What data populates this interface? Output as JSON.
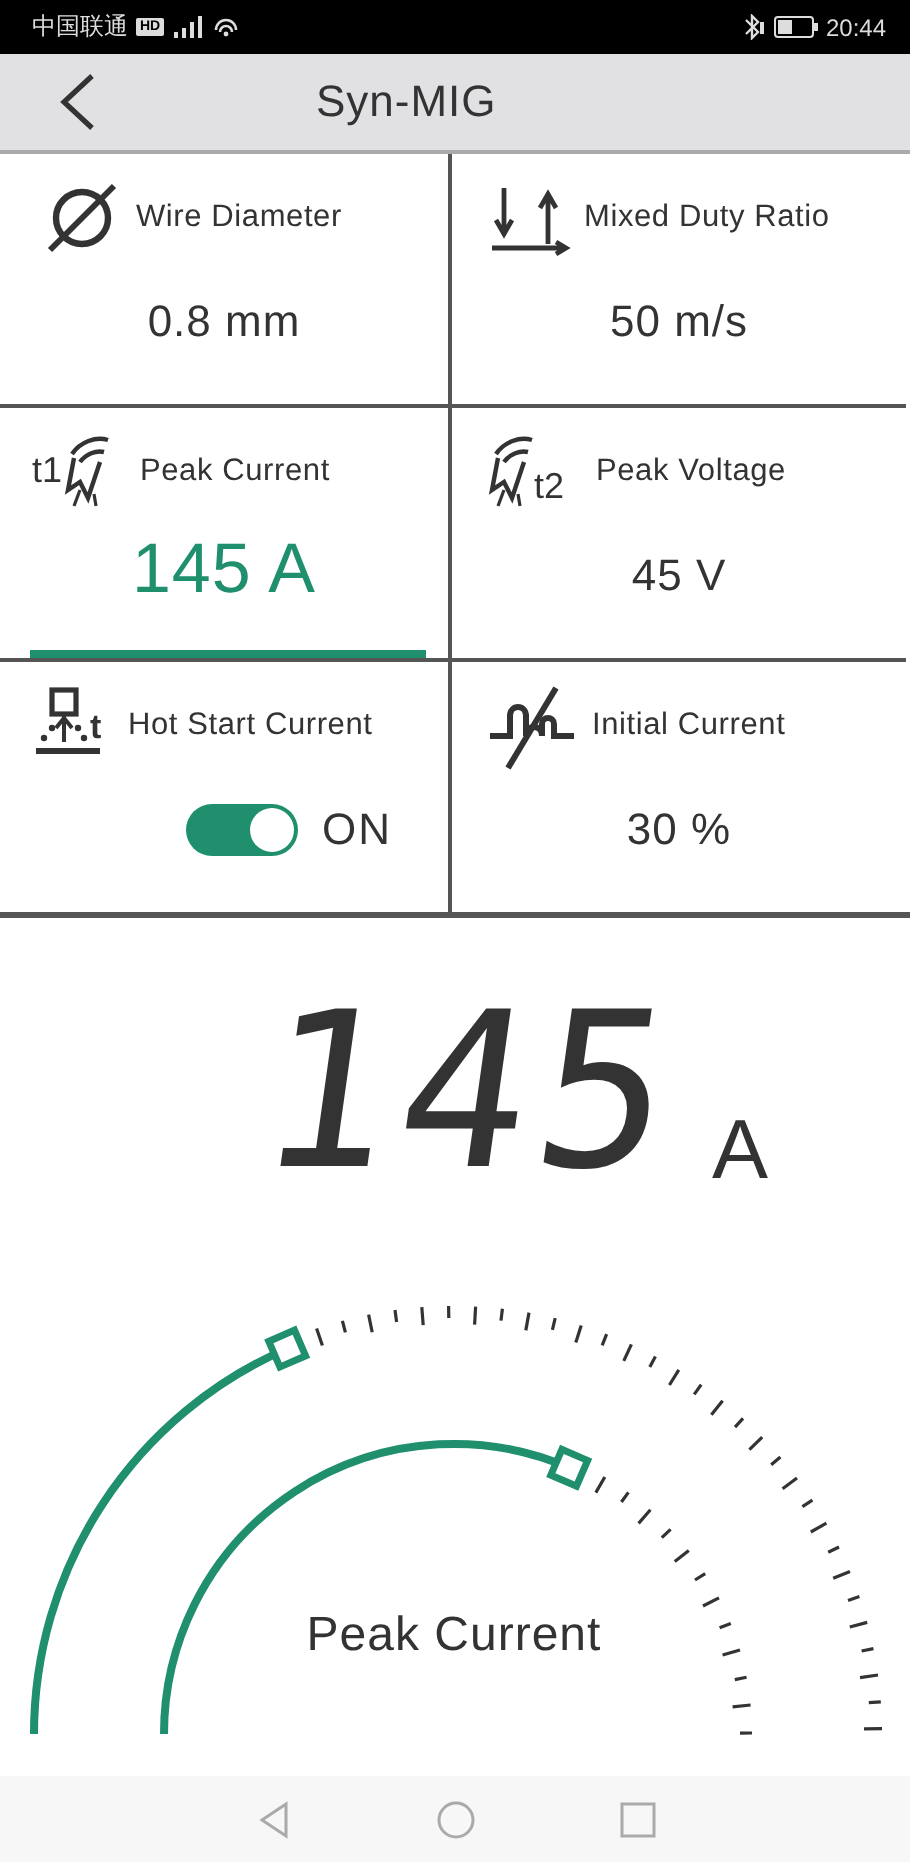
{
  "status_bar": {
    "carrier": "中国联通",
    "network": "HD",
    "time": "20:44"
  },
  "header": {
    "title": "Syn-MIG"
  },
  "parameters": [
    {
      "kind": "value",
      "label": "Wire Diameter",
      "value": "0.8 mm",
      "selected": false
    },
    {
      "kind": "value",
      "label": "Mixed Duty Ratio",
      "value": "50 m/s",
      "selected": false
    },
    {
      "kind": "value",
      "label": "Peak Current",
      "icon_text": "t1",
      "value": "145 A",
      "selected": true
    },
    {
      "kind": "value",
      "label": "Peak Voltage",
      "icon_text": "t2",
      "value": "45 V",
      "selected": false
    },
    {
      "kind": "toggle",
      "label": "Hot Start Current",
      "icon_text": "t",
      "value": "ON",
      "on": true,
      "selected": false
    },
    {
      "kind": "value",
      "label": "Initial Current",
      "value": "30 %",
      "selected": false
    }
  ],
  "reading": {
    "value": "145",
    "unit": "A"
  },
  "gauge": {
    "label": "Peak Current"
  }
}
